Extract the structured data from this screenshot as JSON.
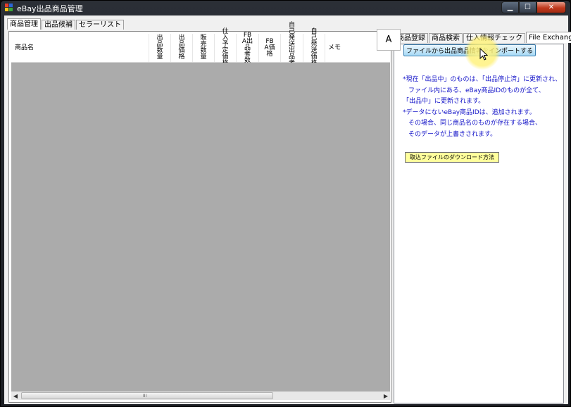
{
  "window": {
    "title": "eBay出品商品管理",
    "controls": [
      "minimize",
      "maximize",
      "close"
    ]
  },
  "main_tabs": [
    {
      "label": "商品管理",
      "active": true
    },
    {
      "label": "出品候補",
      "active": false
    },
    {
      "label": "セラーリスト",
      "active": false
    }
  ],
  "grid": {
    "columns": [
      "商品名",
      "出品数量",
      "出品価格",
      "販売数量",
      "仕入予定価格",
      "FBA出品者数",
      "FBA価格",
      "自己発送出品者数",
      "自己発送価格",
      "メモ"
    ],
    "scroll_grip": "III"
  },
  "right_tabs": [
    {
      "label": "商品登録",
      "active": false
    },
    {
      "label": "商品検索",
      "active": false
    },
    {
      "label": "仕入情報チェック",
      "active": false
    },
    {
      "label": "File Exchange",
      "active": true
    }
  ],
  "tooltip": "A",
  "import_button": "ファイルから出品商品情報をインポートする",
  "info_lines": [
    "*現在「出品中」のものは、「出品停止済」に更新され、",
    "ファイル内にある、eBay商品IDのものが全て、",
    "「出品中」に更新されます。",
    "*データにないeBay商品IDは、追加されます。",
    "その場合、同じ商品名のものが存在する場合、",
    "そのデータが上書きされます。"
  ],
  "download_button": "取込ファイルのダウンロード方法",
  "icons": {
    "minimize": "minimize-icon",
    "maximize": "maximize-icon",
    "close": "close-icon",
    "app": "app-icon"
  }
}
